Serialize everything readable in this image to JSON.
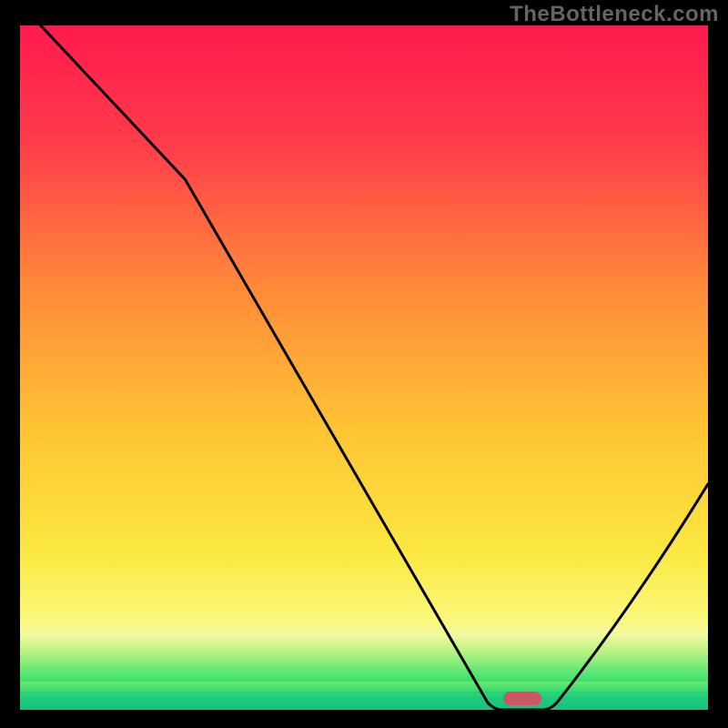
{
  "watermark": "TheBottleneck.com",
  "chart_data": {
    "type": "line",
    "title": "",
    "xlabel": "",
    "ylabel": "",
    "xlim": [
      0,
      100
    ],
    "ylim": [
      0,
      100
    ],
    "optimum_x": 73,
    "curve": [
      {
        "x": 3,
        "y": 100
      },
      {
        "x": 24,
        "y": 77.5
      },
      {
        "x": 68,
        "y": 1
      },
      {
        "x": 70,
        "y": 0
      },
      {
        "x": 76,
        "y": 0
      },
      {
        "x": 78,
        "y": 1
      },
      {
        "x": 100,
        "y": 33
      }
    ],
    "bands": [
      {
        "from": 100,
        "to": 4.2,
        "top": "#ff1a4e",
        "bot": "#37e270"
      },
      {
        "from": 4.2,
        "to": 2.6,
        "top": "#6fe96f",
        "bot": "#2fdc72"
      },
      {
        "from": 2.6,
        "to": 1.8,
        "top": "#2ad876",
        "bot": "#22d07a"
      },
      {
        "from": 1.8,
        "to": 0.0,
        "top": "#1ecc7d",
        "bot": "#14c282"
      }
    ],
    "marker": {
      "x": 73,
      "width_pct": 5.6
    }
  }
}
